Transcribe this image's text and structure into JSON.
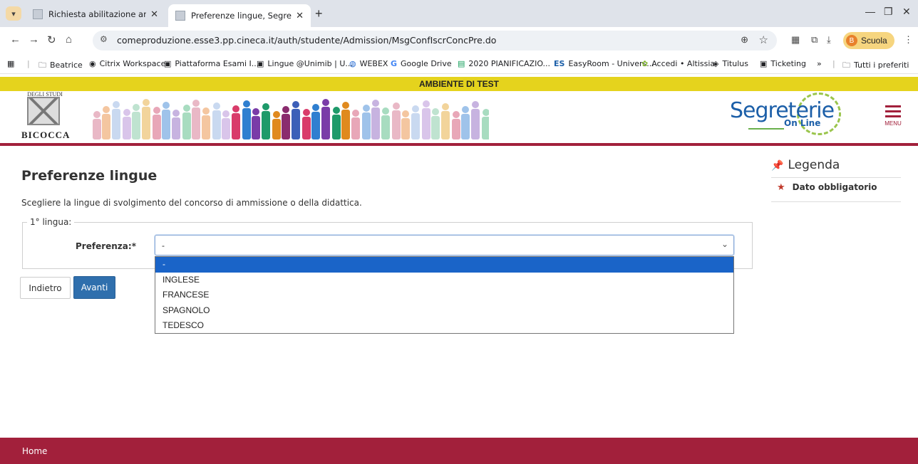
{
  "browser": {
    "tabs": [
      {
        "title": "Richiesta abilitazione area test",
        "active": false
      },
      {
        "title": "Preferenze lingue, Segreterie O",
        "active": true
      }
    ],
    "url": "comeproduzione.esse3.pp.cineca.it/auth/studente/Admission/MsgConfIscrConcPre.do",
    "profile_initial": "B",
    "profile_name": "Scuola",
    "bookmarks": [
      {
        "label": "Beatrice",
        "icon": "folder-icon"
      },
      {
        "label": "Citrix Workspace",
        "icon": "citrix-icon"
      },
      {
        "label": "Piattaforma Esami I...",
        "icon": "page-icon"
      },
      {
        "label": "Lingue @Unimib | U...",
        "icon": "page-icon"
      },
      {
        "label": "WEBEX",
        "icon": "webex-icon"
      },
      {
        "label": "Google Drive",
        "icon": "google-icon"
      },
      {
        "label": "2020 PIANIFICAZIO...",
        "icon": "sheets-icon"
      },
      {
        "label": "EasyRoom - Univers...",
        "icon": "easyroom-icon"
      },
      {
        "label": "Accedi • Altissia",
        "icon": "altissia-icon"
      },
      {
        "label": "Titulus",
        "icon": "titulus-icon"
      },
      {
        "label": "Ticketing",
        "icon": "page-icon"
      }
    ],
    "more_bookmarks": "»",
    "all_bookmarks": "Tutti i preferiti"
  },
  "banner": {
    "test_env": "AMBIENTE DI TEST"
  },
  "logo": {
    "top_text": "DEGLI STUDI",
    "bottom_text": "BICOCCA"
  },
  "segreterie": {
    "word1": "Segreterie",
    "word2": "On Line"
  },
  "menu": {
    "label": "MENU"
  },
  "page": {
    "title": "Preferenze lingue",
    "instructions": "Scegliere la lingue di svolgimento del concorso di ammissione o della didattica.",
    "fieldset_legend": "1° lingua:",
    "preference_label": "Preferenza:*",
    "select_value": "-",
    "options": [
      "-",
      "INGLESE",
      "FRANCESE",
      "SPAGNOLO",
      "TEDESCO"
    ],
    "selected_option": "-",
    "back_label": "Indietro",
    "next_label": "Avanti"
  },
  "legend": {
    "title": "Legenda",
    "required": "Dato obbligatorio",
    "required_marker": "★"
  },
  "footer": {
    "home": "Home"
  },
  "colors": {
    "brand": "#a2203b",
    "test_banner": "#e5d31d",
    "primary_button": "#2f6fad",
    "selected_option": "#1a64c8"
  }
}
